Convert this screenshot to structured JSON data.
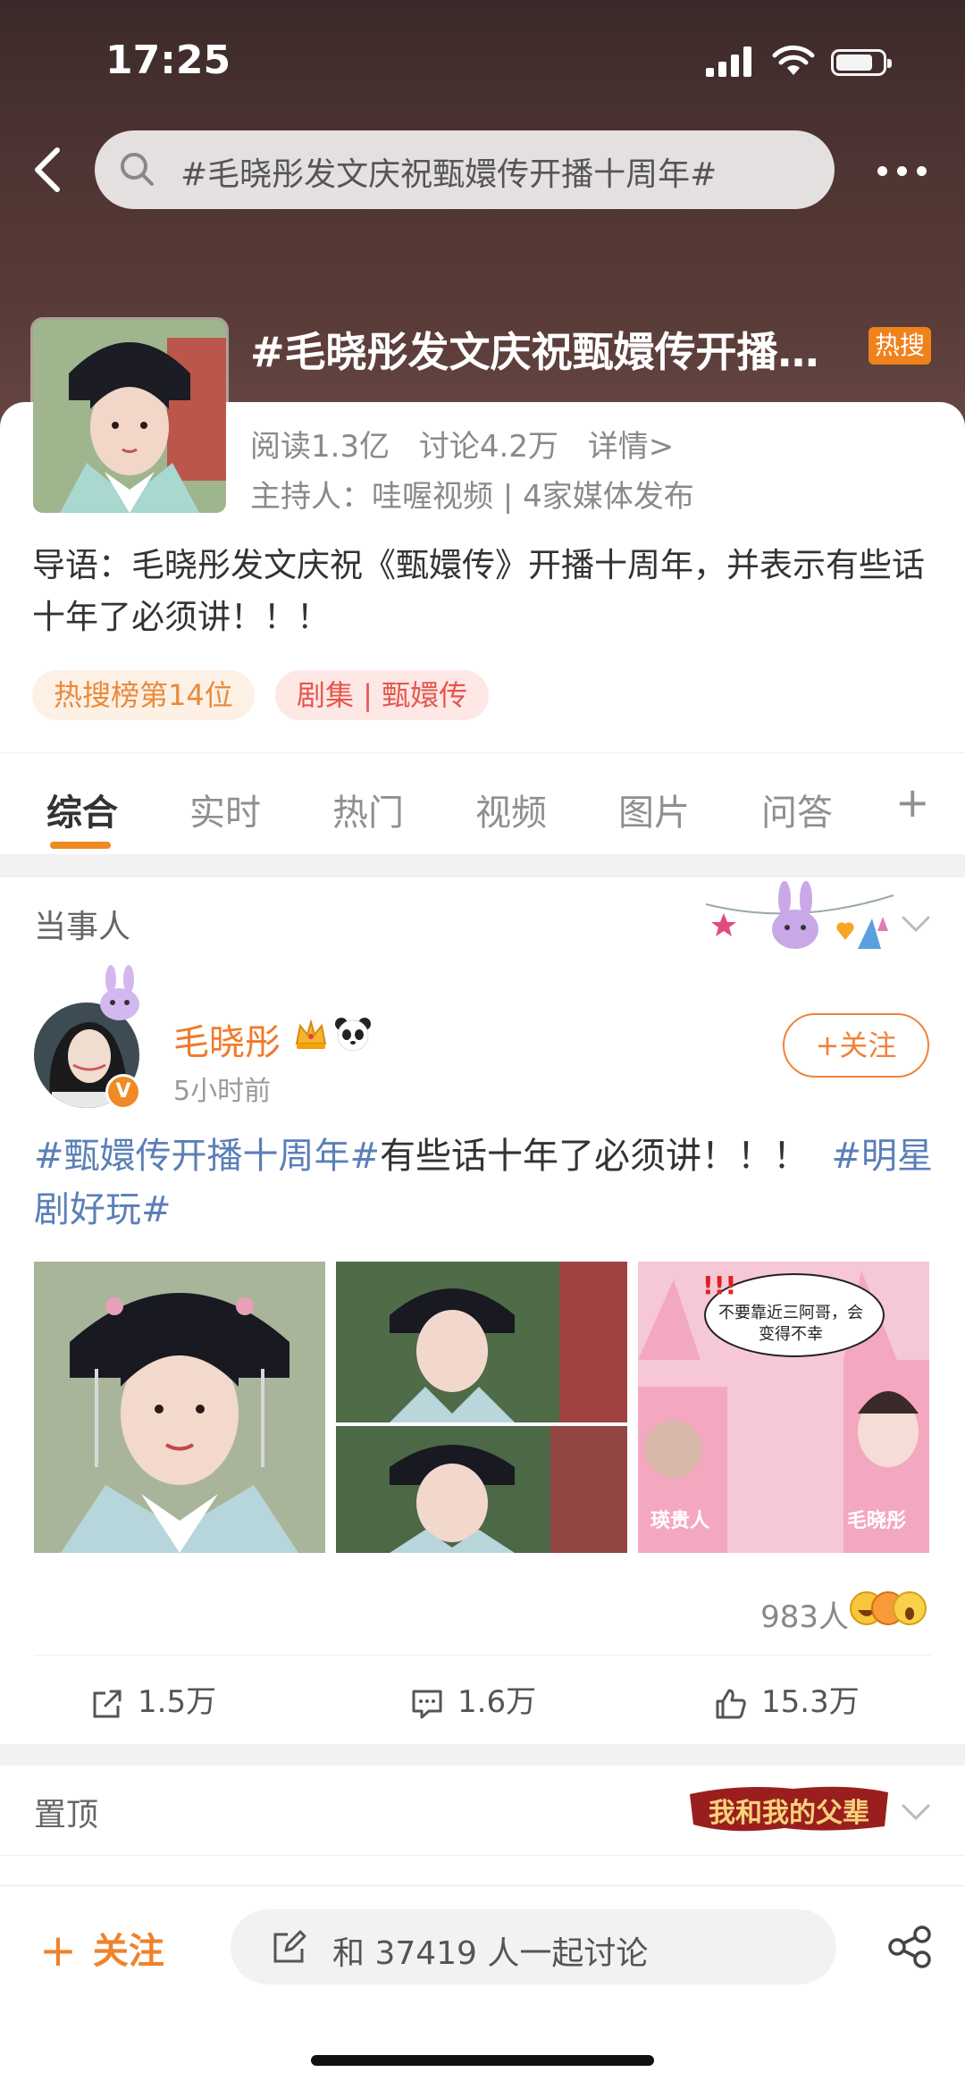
{
  "status_bar": {
    "time": "17:25"
  },
  "search": {
    "query": "#毛晓彤发文庆祝甄嬛传开播十周年#"
  },
  "topic": {
    "title": "#毛晓彤发文庆祝甄嬛传开播十周年#",
    "hot_badge": "热搜",
    "reads": "阅读1.3亿",
    "discussions": "讨论4.2万",
    "details_link": "详情>",
    "host": "主持人：哇喔视频 | 4家媒体发布",
    "intro": "导语：毛晓彤发文庆祝《甄嬛传》开播十周年，并表示有些话十年了必须讲！！！",
    "chips": [
      "热搜榜第14位",
      "剧集 | 甄嬛传"
    ]
  },
  "tabs": [
    "综合",
    "实时",
    "热门",
    "视频",
    "图片",
    "问答"
  ],
  "tabs_add": "+",
  "sections": {
    "party": "当事人",
    "pinned": "置顶"
  },
  "post": {
    "username": "毛晓彤",
    "time": "5小时前",
    "follow_label": "+关注",
    "verified_mark": "V",
    "text_tag1": "#甄嬛传开播十周年#",
    "text_body": "有些话十年了必须讲！！！",
    "text_tag2": "#明星剧好玩#",
    "meme_bubble": "不要靠近三阿哥，会变得不幸",
    "meme_exclaim": "!!!",
    "meme_label_left": "瑛贵人",
    "meme_label_right": "毛晓彤",
    "reactions_count": "983人",
    "shares": "1.5万",
    "comments": "1.6万",
    "likes": "15.3万"
  },
  "pinned_banner": "我和我的父辈",
  "bottom_bar": {
    "follow_label": "关注",
    "follow_plus": "+",
    "discuss_placeholder": "和 37419 人一起讨论"
  },
  "colors": {
    "accent": "#f0822a",
    "tag_blue": "#5b7fb8",
    "header_bg": "#4e3432",
    "hot_badge": "#f0821c"
  }
}
